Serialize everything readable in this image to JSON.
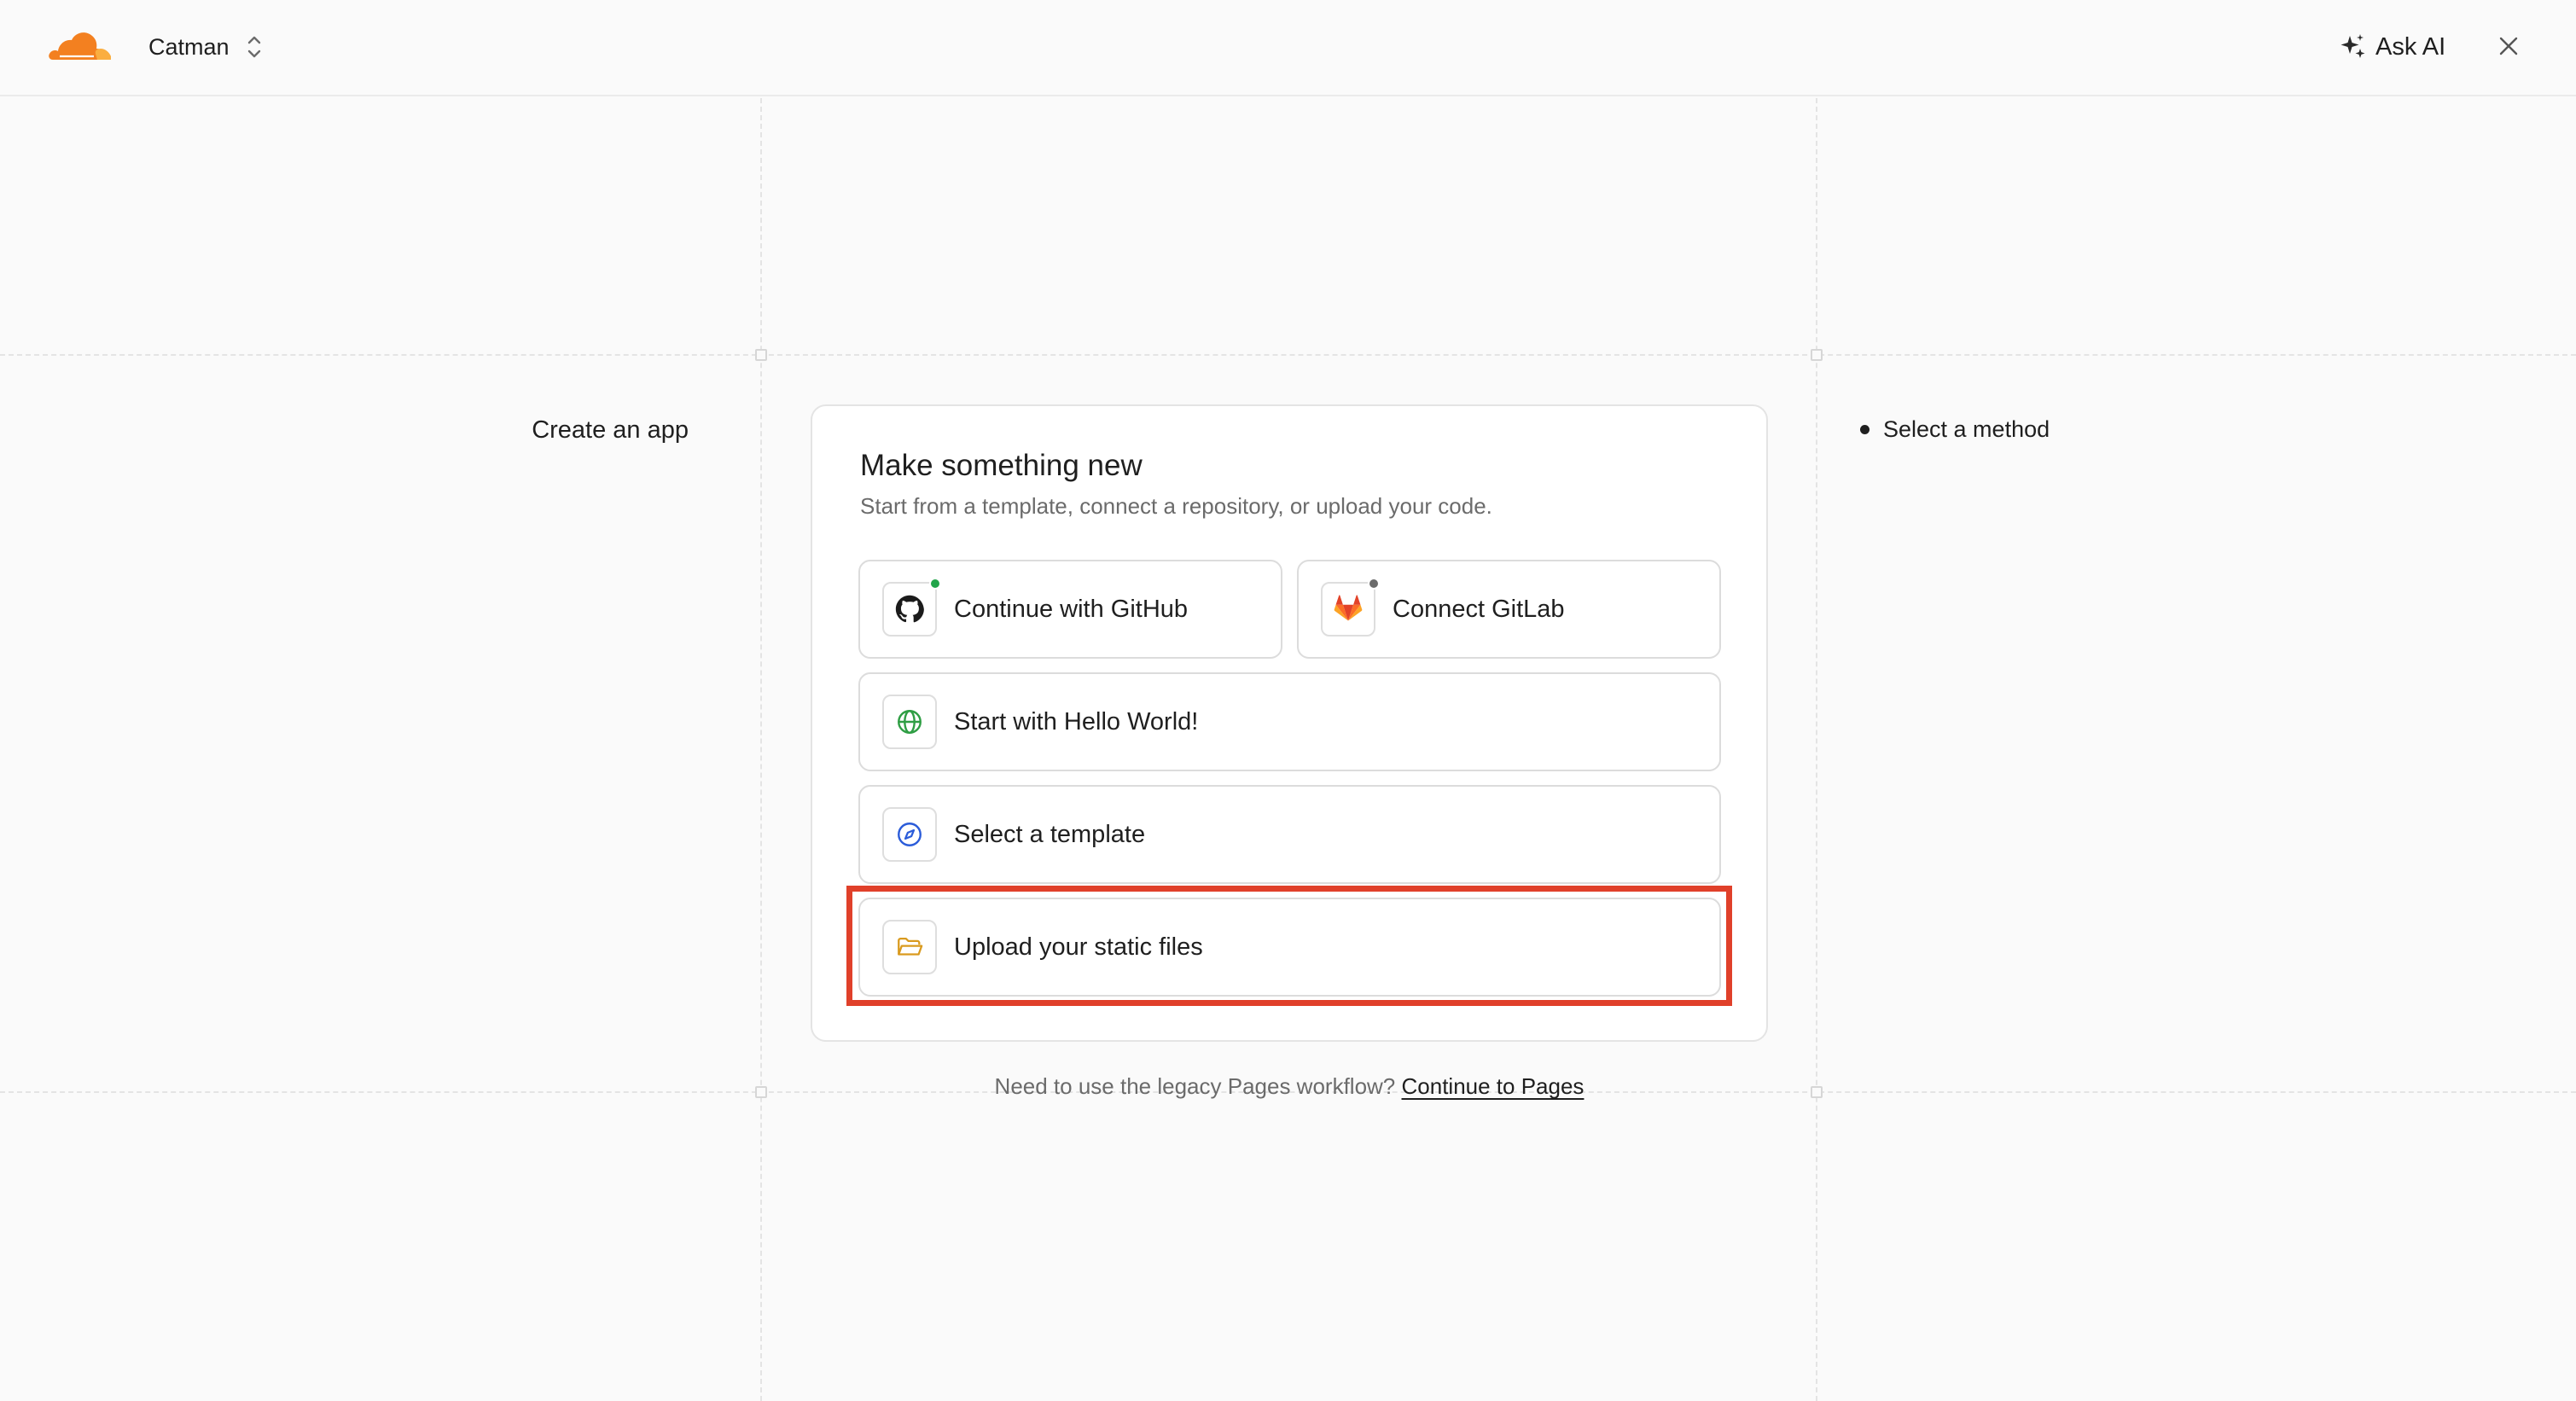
{
  "header": {
    "account_name": "Catman",
    "ask_ai_label": "Ask AI"
  },
  "left_panel": {
    "title": "Create an app"
  },
  "stepper": {
    "steps": [
      {
        "label": "Select a method",
        "active": true
      }
    ]
  },
  "card": {
    "title": "Make something new",
    "subtitle": "Start from a template, connect a repository, or upload your code.",
    "options": {
      "github": {
        "label": "Continue with GitHub",
        "icon": "github-icon",
        "status_color": "#22a54a"
      },
      "gitlab": {
        "label": "Connect GitLab",
        "icon": "gitlab-icon",
        "status_color": "#6b6b6b"
      },
      "hello": {
        "label": "Start with Hello World!",
        "icon": "globe-icon"
      },
      "template": {
        "label": "Select a template",
        "icon": "compass-icon"
      },
      "upload": {
        "label": "Upload your static files",
        "icon": "folder-open-icon",
        "highlighted": true
      }
    }
  },
  "footer": {
    "legacy_text": "Need to use the legacy Pages workflow?",
    "legacy_link": "Continue to Pages"
  },
  "colors": {
    "brand_orange": "#f38020",
    "highlight_red": "#e0402a",
    "globe_green": "#2f9e44",
    "compass_blue": "#2b5cd9",
    "folder_amber": "#d99a1e"
  }
}
